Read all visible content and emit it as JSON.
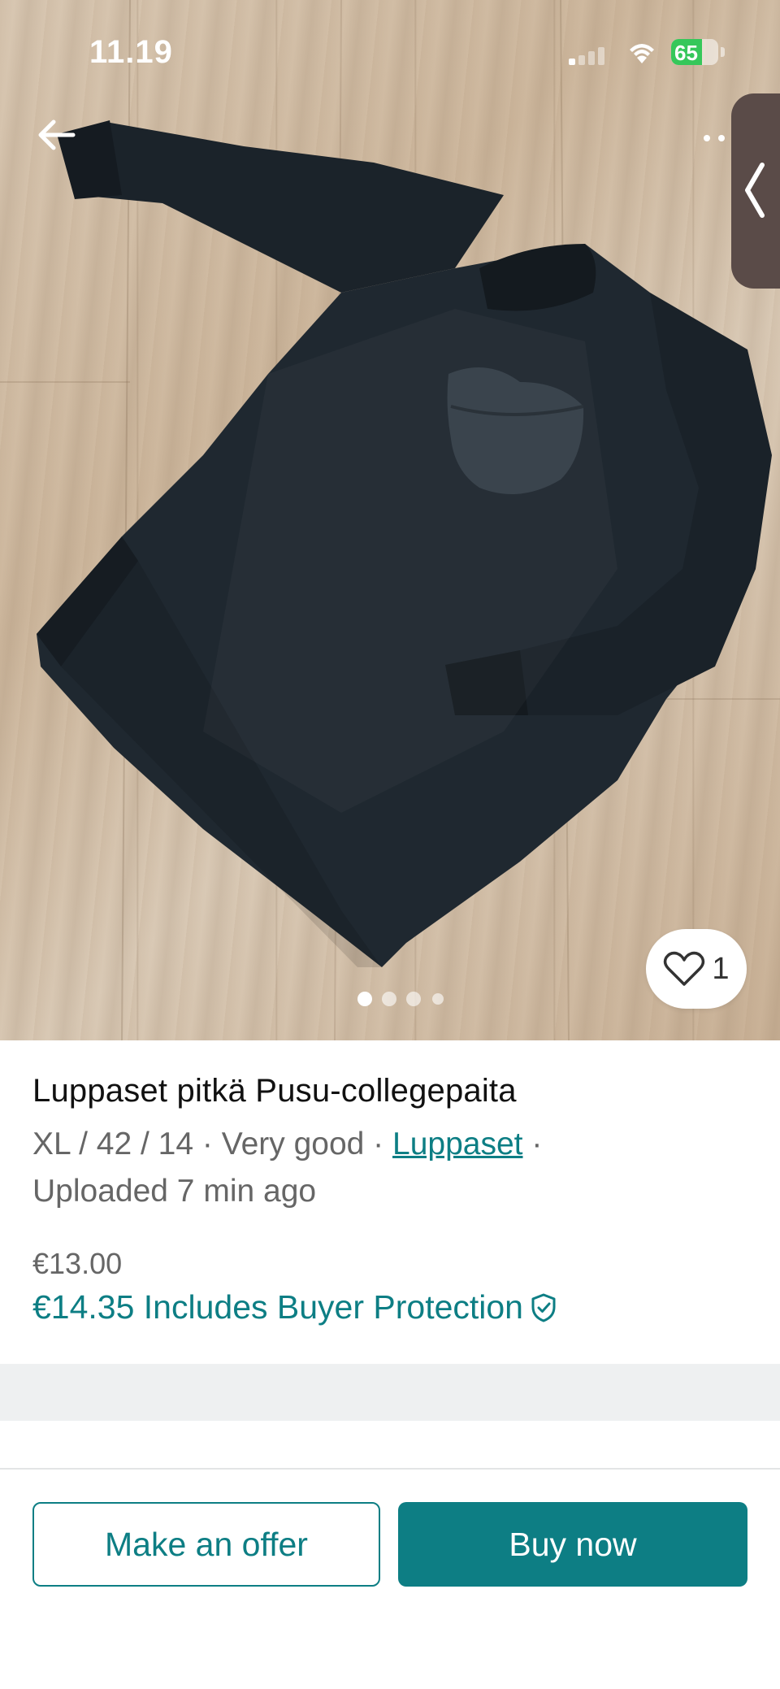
{
  "status_bar": {
    "time": "11.19",
    "battery_percent": "65",
    "battery_level": 0.65,
    "icons": [
      "signal-icon",
      "wifi-icon",
      "battery-charging-icon"
    ]
  },
  "gallery": {
    "image_subject": "black long-sleeve sweatshirt with lips patch on wooden floor",
    "dot_count": 4,
    "active_dot": 1,
    "like_count": "1"
  },
  "listing": {
    "title": "Luppaset pitkä Pusu-collegepaita",
    "size": "XL / 42 / 14",
    "sep1": " · ",
    "condition": "Very good",
    "sep2": " · ",
    "brand": "Luppaset",
    "sep3": " ·",
    "uploaded": "Uploaded 7 min ago",
    "price": "€13.00",
    "price_with_protection": "€14.35 Includes Buyer Protection"
  },
  "actions": {
    "offer_label": "Make an offer",
    "buy_label": "Buy now"
  },
  "colors": {
    "accent": "#0d7e84",
    "battery_green": "#36c75a"
  }
}
